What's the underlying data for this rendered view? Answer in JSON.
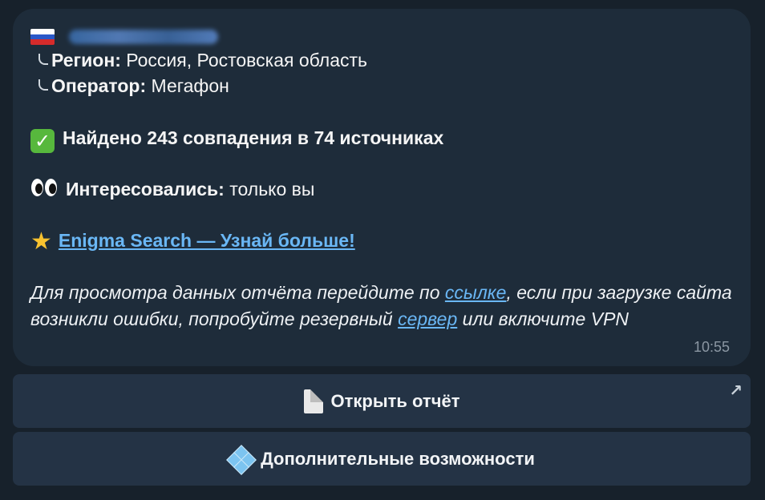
{
  "message": {
    "phone_masked": "+7928XXXXXX3",
    "region_label": "Регион:",
    "region_value": " Россия, Ростовская область",
    "operator_label": "Оператор:",
    "operator_value": " Мегафон",
    "found_text": "Найдено 243 совпадения в 74 источниках",
    "interested_label": "Интересовались:",
    "interested_value": " только вы",
    "promo_link": "Enigma Search — Узнай больше!",
    "note_part1": "Для просмотра данных отчёта перейдите по ",
    "note_link1": "ссылке",
    "note_part2": ", если при загрузке сайта возникли ошибки, попробуйте резервный ",
    "note_link2": "сервер",
    "note_part3": " или включите VPN",
    "time": "10:55"
  },
  "buttons": {
    "open_report": "Открыть отчёт",
    "more_features": "Дополнительные возможности"
  },
  "icons": {
    "flag": "russia-flag-icon",
    "check": "check-mark-icon",
    "eyes": "eyes-icon",
    "star": "star-icon",
    "document": "document-icon",
    "diamonds": "diamonds-icon",
    "external": "external-link-arrow-icon"
  },
  "colors": {
    "background": "#17212b",
    "bubble": "#1e2c3a",
    "link": "#6ab7f5",
    "button": "#243345"
  }
}
